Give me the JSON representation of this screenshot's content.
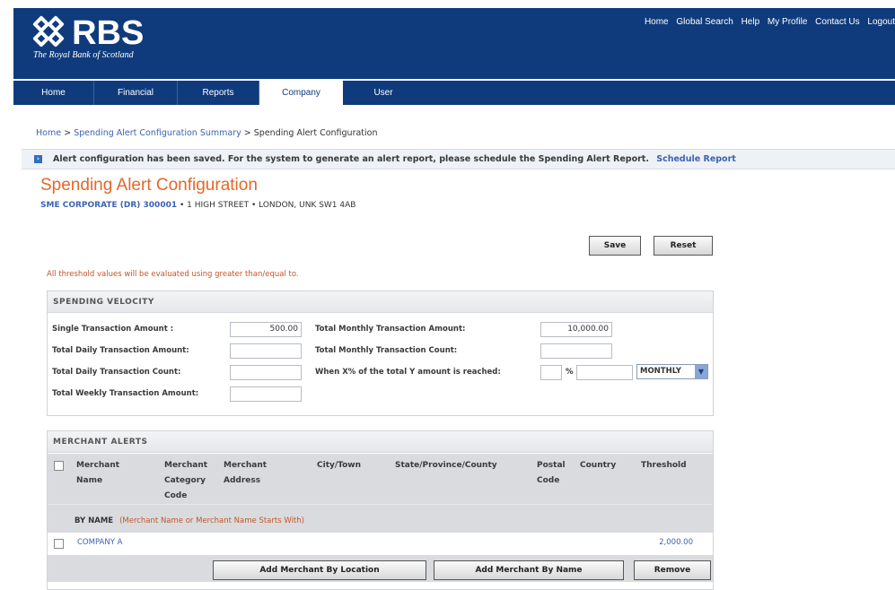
{
  "header": {
    "logo_text": "RBS",
    "logo_tagline": "The Royal Bank of Scotland",
    "toplinks": [
      "Home",
      "Global Search",
      "Help",
      "My Profile",
      "Contact Us",
      "Logout"
    ]
  },
  "nav": {
    "tabs": [
      "Home",
      "Financial",
      "Reports",
      "Company",
      "User"
    ],
    "active": "Company"
  },
  "breadcrumb": {
    "home": "Home",
    "sep": ">",
    "summary": "Spending Alert Configuration Summary",
    "current": "Spending Alert Configuration"
  },
  "message": {
    "text": "Alert configuration has been saved. For the system to generate an alert report, please schedule the Spending Alert Report.",
    "link": "Schedule Report"
  },
  "page": {
    "title": "Spending Alert Configuration",
    "company_link": "SME CORPORATE (DR) 300001",
    "address": "• 1 HIGH STREET • LONDON, UNK SW1 4AB",
    "save": "Save",
    "reset": "Reset",
    "note": "All threshold values will be evaluated using greater than/equal to."
  },
  "velocity": {
    "heading": "SPENDING VELOCITY",
    "single_label": "Single Transaction Amount :",
    "single_value": "500.00",
    "daily_amount_label": "Total Daily Transaction Amount:",
    "daily_amount_value": "",
    "daily_count_label": "Total Daily Transaction Count:",
    "daily_count_value": "",
    "weekly_amount_label": "Total Weekly Transaction Amount:",
    "weekly_amount_value": "",
    "monthly_amount_label": "Total Monthly Transaction Amount:",
    "monthly_amount_value": "10,000.00",
    "monthly_count_label": "Total Monthly Transaction Count:",
    "monthly_count_value": "",
    "xpct_label": "When X% of the total Y amount is reached:",
    "pct_symbol": "%",
    "period_value": "MONTHLY"
  },
  "merchant": {
    "heading": "MERCHANT ALERTS",
    "columns": {
      "name": "Merchant Name",
      "category": "Merchant Category Code",
      "address": "Merchant Address",
      "city": "City/Town",
      "state": "State/Province/County",
      "postal": "Postal Code",
      "country": "Country",
      "threshold": "Threshold"
    },
    "by_name_label": "BY NAME",
    "by_name_note": "(Merchant Name or Merchant Name Starts With)",
    "rows": [
      {
        "name": "COMPANY A",
        "threshold": "2,000.00"
      }
    ],
    "add_location": "Add Merchant By Location",
    "add_name": "Add Merchant By Name",
    "remove": "Remove"
  }
}
